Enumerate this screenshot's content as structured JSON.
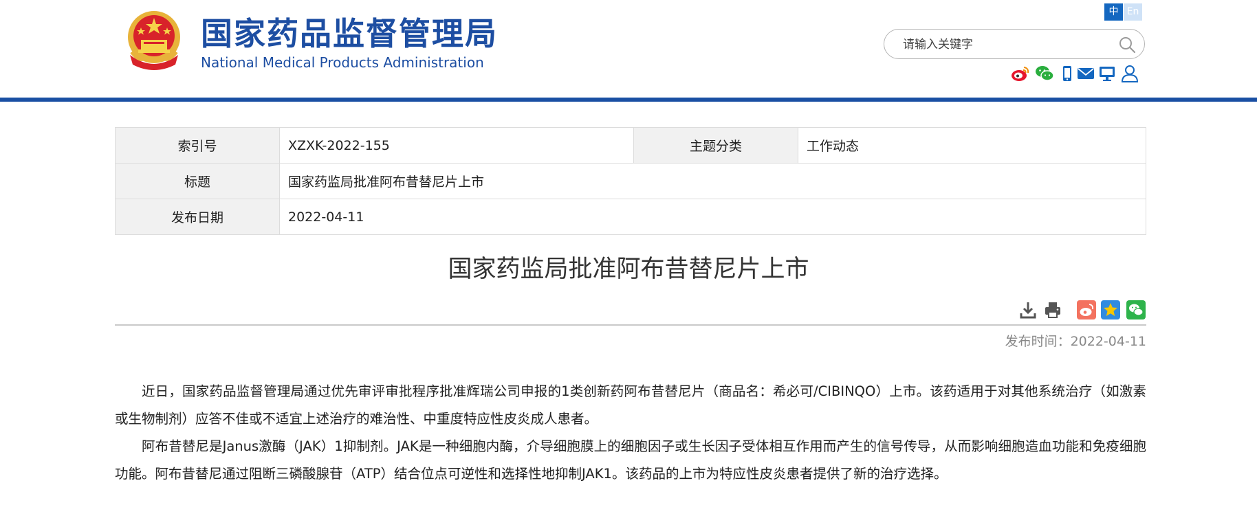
{
  "header": {
    "site_name_cn": "国家药品监督管理局",
    "site_name_en": "National Medical Products Administration",
    "lang_cn": "中",
    "lang_en": "En",
    "search_placeholder": "请输入关键字",
    "social_icons": [
      "weibo-icon",
      "wechat-icon",
      "mobile-icon",
      "mail-icon",
      "monitor-icon",
      "user-icon"
    ],
    "brand_color": "#1a4fa3"
  },
  "info": {
    "index_label": "索引号",
    "index_value": "XZXK-2022-155",
    "topic_label": "主题分类",
    "topic_value": "工作动态",
    "title_label": "标题",
    "title_value": "国家药监局批准阿布昔替尼片上市",
    "date_label": "发布日期",
    "date_value": "2022-04-11"
  },
  "article": {
    "title": "国家药监局批准阿布昔替尼片上市",
    "tool_icons": [
      "download-icon",
      "print-icon",
      "share-weibo-icon",
      "favorite-star-icon",
      "share-wechat-icon"
    ],
    "publish_label": "发布时间：",
    "publish_date": "2022-04-11",
    "paragraphs": [
      "近日，国家药品监督管理局通过优先审评审批程序批准辉瑞公司申报的1类创新药阿布昔替尼片（商品名：希必可/CIBINQO）上市。该药适用于对其他系统治疗（如激素或生物制剂）应答不佳或不适宜上述治疗的难治性、中重度特应性皮炎成人患者。",
      "阿布昔替尼是Janus激酶（JAK）1抑制剂。JAK是一种细胞内酶，介导细胞膜上的细胞因子或生长因子受体相互作用而产生的信号传导，从而影响细胞造血功能和免疫细胞功能。阿布昔替尼通过阻断三磷酸腺苷（ATP）结合位点可逆性和选择性地抑制JAK1。该药品的上市为特应性皮炎患者提供了新的治疗选择。"
    ]
  }
}
